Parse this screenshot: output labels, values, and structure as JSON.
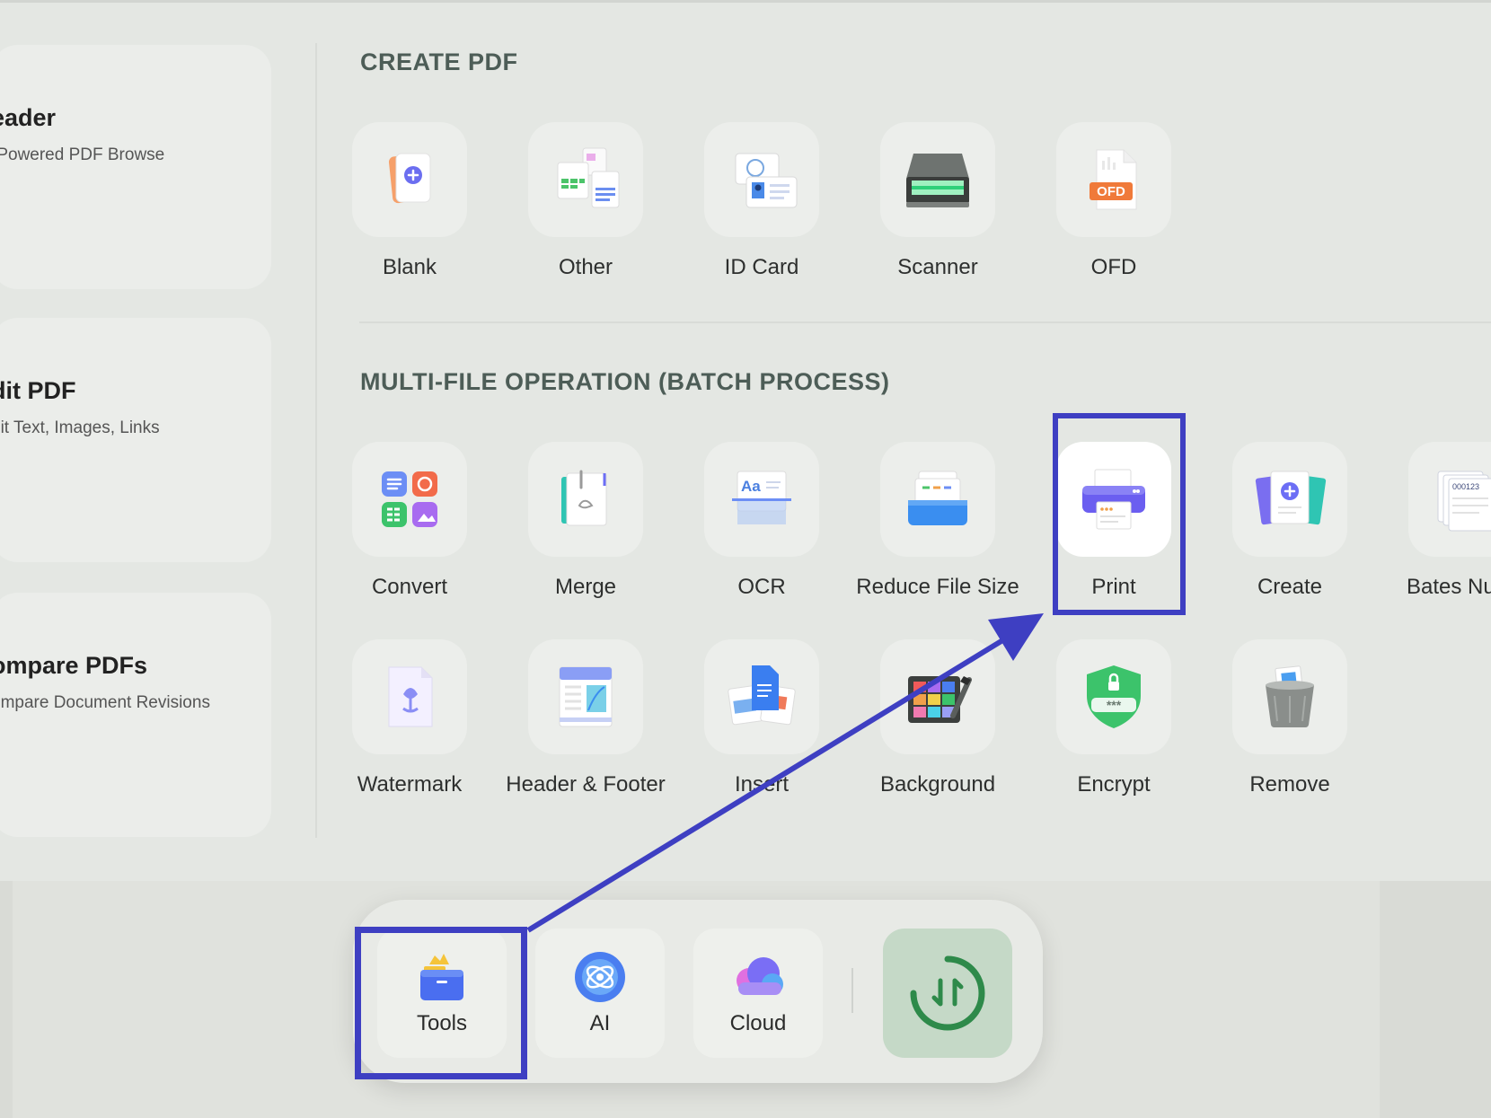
{
  "accent_color": "#3e3fc2",
  "feature_cards": [
    {
      "title": "eader",
      "subtitle": "-Powered PDF Browse"
    },
    {
      "title": "dit PDF",
      "subtitle": "dit Text, Images, Links"
    },
    {
      "title": "ompare PDFs",
      "subtitle": "ompare Document Revisions"
    }
  ],
  "sections": {
    "create_pdf": {
      "title": "CREATE PDF",
      "tools": [
        {
          "label": "Blank",
          "icon": "blank-page-icon"
        },
        {
          "label": "Other",
          "icon": "other-files-icon"
        },
        {
          "label": "ID Card",
          "icon": "id-card-icon"
        },
        {
          "label": "Scanner",
          "icon": "scanner-icon"
        },
        {
          "label": "OFD",
          "icon": "ofd-file-icon",
          "badge": "OFD"
        }
      ]
    },
    "multi_file": {
      "title": "MULTI-FILE OPERATION (BATCH PROCESS)",
      "tools": [
        {
          "label": "Convert",
          "icon": "convert-icon"
        },
        {
          "label": "Merge",
          "icon": "merge-icon"
        },
        {
          "label": "OCR",
          "icon": "ocr-icon",
          "glyph": "Aa"
        },
        {
          "label": "Reduce File Size",
          "icon": "reduce-file-size-icon"
        },
        {
          "label": "Print",
          "icon": "printer-icon"
        },
        {
          "label": "Create",
          "icon": "create-icon"
        },
        {
          "label": "Bates Numb",
          "icon": "bates-number-icon",
          "glyph": "000123"
        },
        {
          "label": "Watermark",
          "icon": "watermark-icon"
        },
        {
          "label": "Header & Footer",
          "icon": "header-footer-icon"
        },
        {
          "label": "Insert",
          "icon": "insert-icon"
        },
        {
          "label": "Background",
          "icon": "background-icon"
        },
        {
          "label": "Encrypt",
          "icon": "encrypt-icon",
          "glyph": "***"
        },
        {
          "label": "Remove",
          "icon": "remove-trash-icon"
        }
      ]
    }
  },
  "dock": {
    "items": [
      {
        "label": "Tools",
        "icon": "tools-toolbox-icon"
      },
      {
        "label": "AI",
        "icon": "ai-icon"
      },
      {
        "label": "Cloud",
        "icon": "cloud-icon"
      }
    ],
    "sync_icon": "sync-transfer-icon"
  }
}
